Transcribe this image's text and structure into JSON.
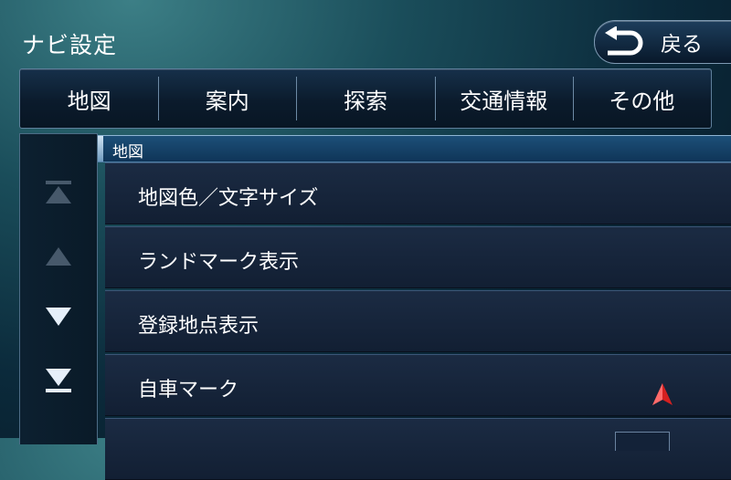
{
  "header": {
    "title": "ナビ設定",
    "back_label": "戻る"
  },
  "tabs": [
    {
      "label": "地図"
    },
    {
      "label": "案内"
    },
    {
      "label": "探索"
    },
    {
      "label": "交通情報"
    },
    {
      "label": "その他"
    }
  ],
  "section": {
    "label": "地図"
  },
  "scroll": {
    "top_icon": "scroll-to-top-icon",
    "up_icon": "scroll-up-icon",
    "down_icon": "scroll-down-icon",
    "bottom_icon": "scroll-to-bottom-icon"
  },
  "menu_items": [
    {
      "label": "地図色／文字サイズ"
    },
    {
      "label": "ランドマーク表示"
    },
    {
      "label": "登録地点表示"
    },
    {
      "label": "自車マーク",
      "icon": "car-mark-arrow-icon"
    },
    {
      "label": ""
    }
  ],
  "colors": {
    "accent": "#1c4f78",
    "car_mark": "#d42020",
    "active_arrow": "#e6effa",
    "disabled_arrow": "#47596b"
  }
}
